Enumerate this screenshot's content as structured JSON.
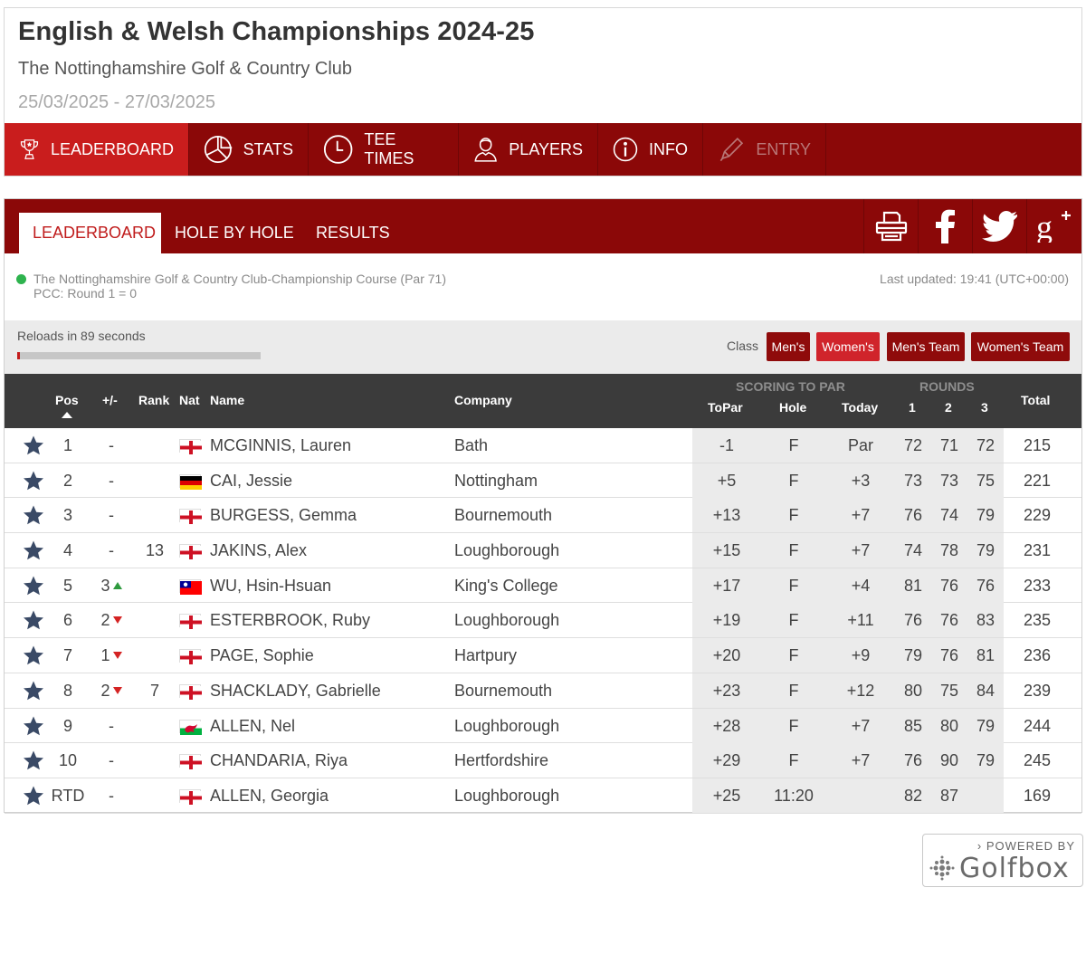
{
  "event": {
    "title": "English & Welsh Championships 2024-25",
    "venue": "The Nottinghamshire Golf & Country Club",
    "dates": "25/03/2025 - 27/03/2025"
  },
  "main_nav": [
    {
      "label": "LEADERBOARD",
      "icon": "trophy-icon",
      "active": true
    },
    {
      "label": "STATS",
      "icon": "pie-chart-icon"
    },
    {
      "label": "TEE TIMES",
      "icon": "clock-icon"
    },
    {
      "label": "PLAYERS",
      "icon": "person-icon"
    },
    {
      "label": "INFO",
      "icon": "info-icon"
    },
    {
      "label": "ENTRY",
      "icon": "pencil-icon",
      "disabled": true
    }
  ],
  "sub_nav": [
    {
      "label": "LEADERBOARD",
      "active": true
    },
    {
      "label": "HOLE BY HOLE"
    },
    {
      "label": "RESULTS"
    }
  ],
  "share": [
    "print-icon",
    "facebook-icon",
    "twitter-icon",
    "google-plus-icon"
  ],
  "course": {
    "name": "The Nottinghamshire Golf & Country Club-Championship Course (Par 71)",
    "pcc": "PCC: Round 1 = 0",
    "last_updated": "Last updated: 19:41 (UTC+00:00)"
  },
  "reload": {
    "text": "Reloads in 89 seconds",
    "progress_fraction": 0.01
  },
  "class_filter": {
    "label": "Class",
    "options": [
      {
        "label": "Men's"
      },
      {
        "label": "Women's",
        "active": true
      },
      {
        "label": "Men's Team"
      },
      {
        "label": "Women's Team"
      }
    ]
  },
  "columns": {
    "pos": "Pos",
    "movement": "+/-",
    "rank": "Rank",
    "nat": "Nat",
    "name": "Name",
    "company": "Company",
    "scoring_group": "SCORING TO PAR",
    "topar": "ToPar",
    "hole": "Hole",
    "today": "Today",
    "rounds_group": "ROUNDS",
    "r1": "1",
    "r2": "2",
    "r3": "3",
    "total": "Total"
  },
  "players": [
    {
      "pos": "1",
      "move": "-",
      "dir": "",
      "rank": "",
      "flag": "england",
      "name": "MCGINNIS, Lauren",
      "company": "Bath",
      "topar": "-1",
      "hole": "F",
      "today": "Par",
      "r1": "72",
      "r2": "71",
      "r3": "72",
      "total": "215"
    },
    {
      "pos": "2",
      "move": "-",
      "dir": "",
      "rank": "",
      "flag": "germany",
      "name": "CAI, Jessie",
      "company": "Nottingham",
      "topar": "+5",
      "hole": "F",
      "today": "+3",
      "r1": "73",
      "r2": "73",
      "r3": "75",
      "total": "221"
    },
    {
      "pos": "3",
      "move": "-",
      "dir": "",
      "rank": "",
      "flag": "england",
      "name": "BURGESS, Gemma",
      "company": "Bournemouth",
      "topar": "+13",
      "hole": "F",
      "today": "+7",
      "r1": "76",
      "r2": "74",
      "r3": "79",
      "total": "229"
    },
    {
      "pos": "4",
      "move": "-",
      "dir": "",
      "rank": "13",
      "flag": "england",
      "name": "JAKINS, Alex",
      "company": "Loughborough",
      "topar": "+15",
      "hole": "F",
      "today": "+7",
      "r1": "74",
      "r2": "78",
      "r3": "79",
      "total": "231"
    },
    {
      "pos": "5",
      "move": "3",
      "dir": "up",
      "rank": "",
      "flag": "taiwan",
      "name": "WU, Hsin-Hsuan",
      "company": "King's College",
      "topar": "+17",
      "hole": "F",
      "today": "+4",
      "r1": "81",
      "r2": "76",
      "r3": "76",
      "total": "233"
    },
    {
      "pos": "6",
      "move": "2",
      "dir": "down",
      "rank": "",
      "flag": "england",
      "name": "ESTERBROOK, Ruby",
      "company": "Loughborough",
      "topar": "+19",
      "hole": "F",
      "today": "+11",
      "r1": "76",
      "r2": "76",
      "r3": "83",
      "total": "235"
    },
    {
      "pos": "7",
      "move": "1",
      "dir": "down",
      "rank": "",
      "flag": "england",
      "name": "PAGE, Sophie",
      "company": "Hartpury",
      "topar": "+20",
      "hole": "F",
      "today": "+9",
      "r1": "79",
      "r2": "76",
      "r3": "81",
      "total": "236"
    },
    {
      "pos": "8",
      "move": "2",
      "dir": "down",
      "rank": "7",
      "flag": "england",
      "name": "SHACKLADY, Gabrielle",
      "company": "Bournemouth",
      "topar": "+23",
      "hole": "F",
      "today": "+12",
      "r1": "80",
      "r2": "75",
      "r3": "84",
      "total": "239"
    },
    {
      "pos": "9",
      "move": "-",
      "dir": "",
      "rank": "",
      "flag": "wales",
      "name": "ALLEN, Nel",
      "company": "Loughborough",
      "topar": "+28",
      "hole": "F",
      "today": "+7",
      "r1": "85",
      "r2": "80",
      "r3": "79",
      "total": "244"
    },
    {
      "pos": "10",
      "move": "-",
      "dir": "",
      "rank": "",
      "flag": "england",
      "name": "CHANDARIA, Riya",
      "company": "Hertfordshire",
      "topar": "+29",
      "hole": "F",
      "today": "+7",
      "r1": "76",
      "r2": "90",
      "r3": "79",
      "total": "245"
    },
    {
      "pos": "RTD",
      "move": "-",
      "dir": "",
      "rank": "",
      "flag": "england",
      "name": "ALLEN, Georgia",
      "company": "Loughborough",
      "topar": "+25",
      "hole": "11:20",
      "today": "",
      "r1": "82",
      "r2": "87",
      "r3": "",
      "total": "169"
    }
  ],
  "powered_by": {
    "label": "POWERED BY",
    "brand": "Golfbox"
  },
  "colors": {
    "brand_dark": "#8b0808",
    "brand_active": "#c91d1d",
    "header_dark": "#3b3b3b",
    "star": "#3a4a66"
  }
}
